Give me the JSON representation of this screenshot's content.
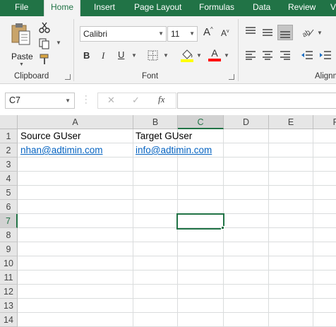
{
  "ribbon_tabs": {
    "file": "File",
    "home": "Home",
    "insert": "Insert",
    "page_layout": "Page Layout",
    "formulas": "Formulas",
    "data": "Data",
    "review": "Review",
    "view_partial": "V"
  },
  "clipboard": {
    "paste_label": "Paste",
    "group_label": "Clipboard"
  },
  "font": {
    "name": "Calibri",
    "size": "11",
    "group_label": "Font",
    "bold": "B",
    "italic": "I",
    "underline": "U",
    "grow": "A",
    "shrink": "A",
    "font_color_letter": "A"
  },
  "alignment": {
    "group_label": "Alignm"
  },
  "formula_bar": {
    "name_box": "C7",
    "cancel": "✕",
    "enter": "✓",
    "fx": "fx",
    "value": ""
  },
  "sheet": {
    "columns": [
      "A",
      "B",
      "C",
      "D",
      "E",
      "F"
    ],
    "selected_column": "C",
    "rows": [
      "1",
      "2",
      "3",
      "4",
      "5",
      "6",
      "7",
      "8",
      "9",
      "10",
      "11",
      "12",
      "13",
      "14"
    ],
    "selected_row": "7",
    "cells": {
      "A1": "Source GUser",
      "B1": "Target GUser",
      "A2": "nhan@adtimin.com",
      "B2": "info@adtimin.com"
    },
    "hyperlink_cells": [
      "A2",
      "B2"
    ],
    "active_cell": "C7"
  },
  "colors": {
    "accent": "#217346",
    "hyperlink": "#0563c1",
    "fill_yellow": "#ffff00",
    "font_red": "#ff0000"
  },
  "icons": [
    "cut-icon",
    "copy-icon",
    "format-painter-icon",
    "paste-icon",
    "borders-icon",
    "fill-color-icon",
    "font-color-icon",
    "align-top-icon",
    "align-middle-icon",
    "align-bottom-icon",
    "orientation-icon",
    "align-left-icon",
    "align-center-icon",
    "align-right-icon",
    "decrease-indent-icon",
    "increase-indent-icon",
    "fx-icon"
  ]
}
